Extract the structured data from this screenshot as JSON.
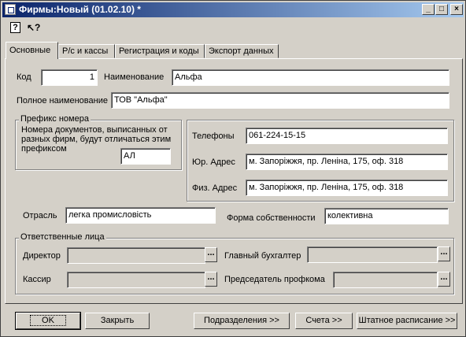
{
  "window": {
    "title": "Фирмы:Новый (01.02.10) *",
    "minimize_icon": "minimize-icon",
    "maximize_icon": "maximize-icon",
    "close_icon": "close-icon"
  },
  "toolbar": {
    "help_glyph": "?",
    "whats_this_glyph": "↖?"
  },
  "tabs": [
    {
      "label": "Основные",
      "active": true
    },
    {
      "label": "Р/с и кассы",
      "active": false
    },
    {
      "label": "Регистрация и коды",
      "active": false
    },
    {
      "label": "Экспорт данных",
      "active": false
    }
  ],
  "main": {
    "code_label": "Код",
    "code_value": "1",
    "name_label": "Наименование",
    "name_value": "Альфа",
    "fullname_label": "Полное наименование",
    "fullname_value": "ТОВ \"Альфа\"",
    "prefix_group_title": "Префикс номера",
    "prefix_desc": "Номера документов, выписанных от разных фирм, будут отличаться этим префиксом",
    "prefix_value": "АЛ",
    "phones_label": "Телефоны",
    "phones_value": "061-224-15-15",
    "legal_addr_label": "Юр. Адрес",
    "legal_addr_value": "м. Запоріжжя, пр. Леніна, 175, оф. 318",
    "phys_addr_label": "Физ. Адрес",
    "phys_addr_value": "м. Запоріжжя, пр. Леніна, 175, оф. 318",
    "industry_label": "Отрасль",
    "industry_value": "легка промисловість",
    "ownership_label": "Форма собственности",
    "ownership_value": "колективна"
  },
  "responsible": {
    "group_title": "Ответственные лица",
    "director_label": "Директор",
    "director_value": "",
    "chief_accountant_label": "Главный бухгалтер",
    "chief_accountant_value": "",
    "cashier_label": "Кассир",
    "cashier_value": "",
    "union_chair_label": "Председатель профкома",
    "union_chair_value": "",
    "ellipsis": "..."
  },
  "buttons": {
    "ok": "OK",
    "close": "Закрыть",
    "departments": "Подразделения >>",
    "accounts": "Счета >>",
    "staff_schedule": "Штатное расписание >>"
  }
}
